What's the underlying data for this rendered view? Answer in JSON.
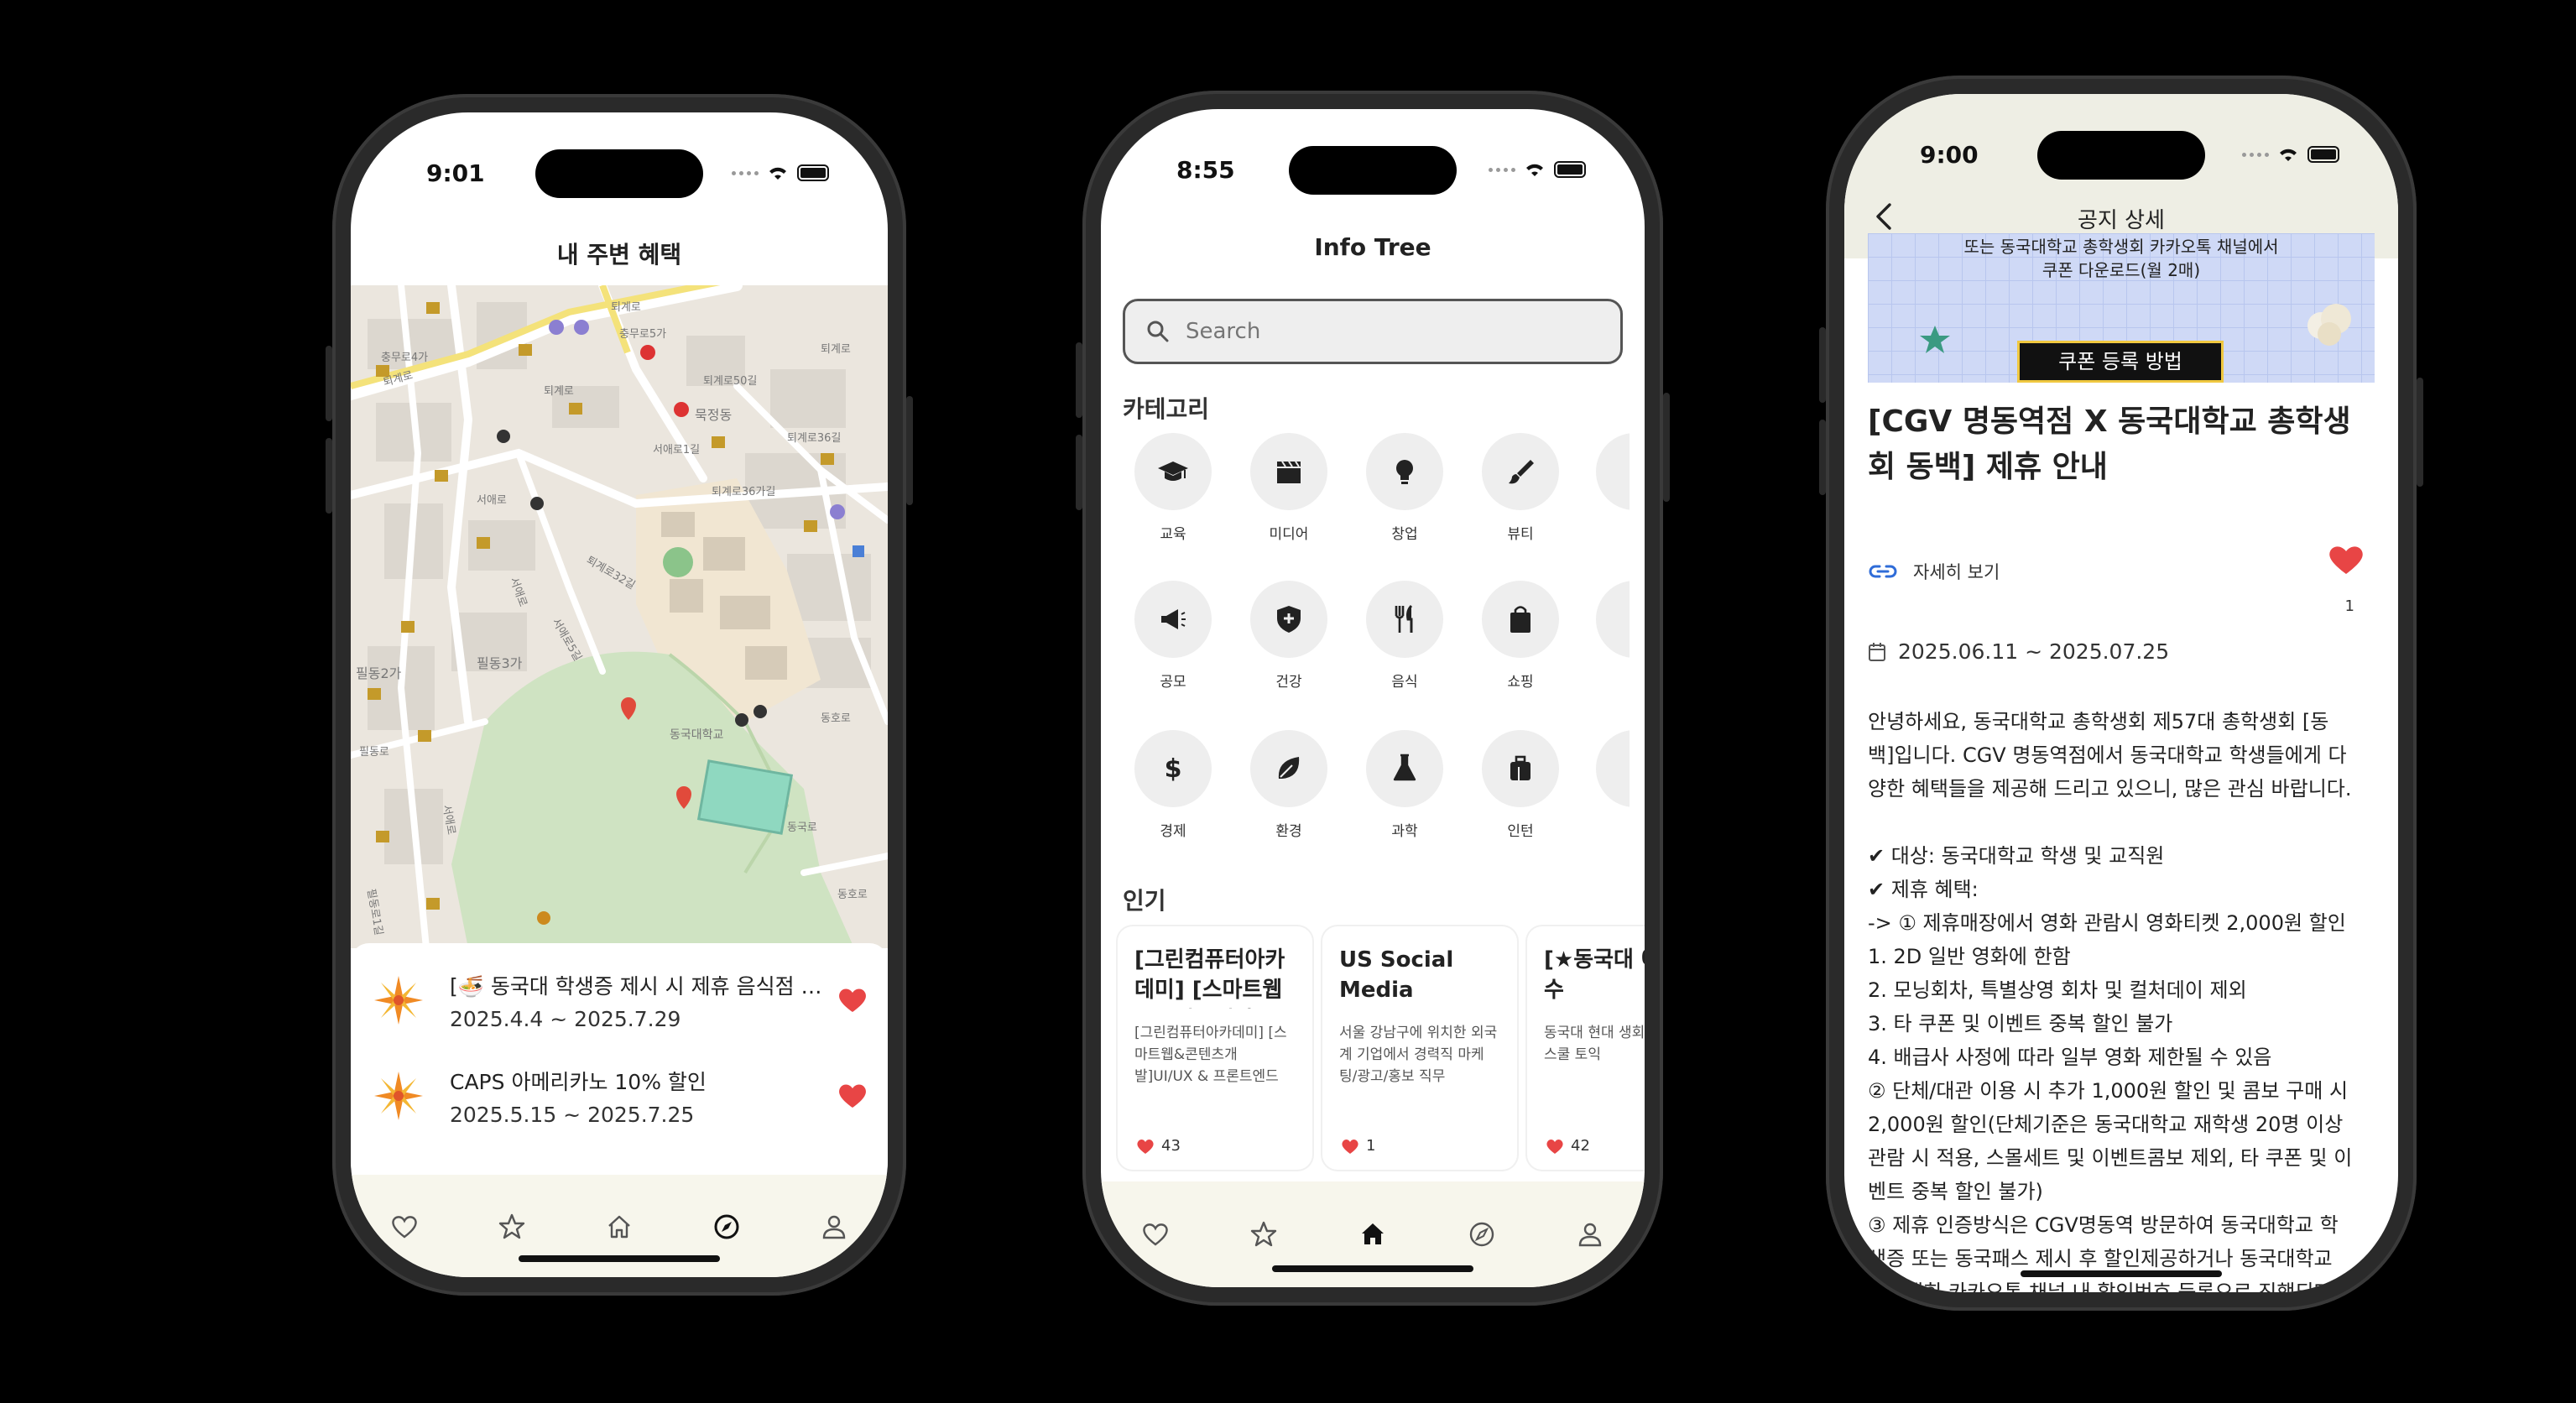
{
  "colors": {
    "accent": "#e84545",
    "tab_bg": "#f7f6ec",
    "link": "#2f6cd8"
  },
  "phone1": {
    "time": "9:01",
    "title": "내 주변 혜택",
    "map_labels": [
      "퇴계로",
      "충무로5가",
      "충무로4가",
      "퇴계로",
      "퇴계로50길",
      "묵정동",
      "서애로1길",
      "필동2가",
      "필동3가",
      "퇴계로",
      "서애로",
      "퇴계로36길",
      "동국대학교",
      "퇴계로32길",
      "퇴계로36가길",
      "필동로",
      "동호로",
      "서애로5길",
      "서애로",
      "필동로1길",
      "서애로",
      "퇴계로",
      "동국로",
      "동호로"
    ],
    "items": [
      {
        "title": "[🍜 동국대 학생증 제시 시 제휴 음식점 안내]",
        "date": "2025.4.4 ~ 2025.7.29"
      },
      {
        "title": "CAPS 아메리카노 10% 할인",
        "date": "2025.5.15 ~ 2025.7.25"
      }
    ],
    "tabs": [
      "heart-icon",
      "star-icon",
      "home-icon",
      "compass-icon",
      "person-icon"
    ]
  },
  "phone2": {
    "time": "8:55",
    "title": "Info Tree",
    "search_placeholder": "Search",
    "category_title": "카테고리",
    "categories": [
      {
        "icon": "graduation-cap-icon",
        "label": "교육"
      },
      {
        "icon": "clapperboard-icon",
        "label": "미디어"
      },
      {
        "icon": "lightbulb-icon",
        "label": "창업"
      },
      {
        "icon": "brush-icon",
        "label": "뷰티"
      },
      {
        "icon": "megaphone-icon",
        "label": "공모"
      },
      {
        "icon": "shield-icon",
        "label": "건강"
      },
      {
        "icon": "utensils-icon",
        "label": "음식"
      },
      {
        "icon": "shopping-bag-icon",
        "label": "쇼핑"
      },
      {
        "icon": "dollar-icon",
        "label": "경제"
      },
      {
        "icon": "leaf-icon",
        "label": "환경"
      },
      {
        "icon": "flask-icon",
        "label": "과학"
      },
      {
        "icon": "briefcase-icon",
        "label": "인턴"
      }
    ],
    "popular_title": "인기",
    "popular": [
      {
        "title": "[그린컴퓨터아카데미] [스마트웹&콘텐츠개발]",
        "desc": "[그린컴퓨터아카데미] [스마트웹&콘텐츠개발]UI/UX & 프론트엔드",
        "likes": "43"
      },
      {
        "title": "US Social Media Marketing",
        "desc": "서울 강남구에 위치한 외국계 기업에서 경력직 마케팅/광고/홍보 직무",
        "likes": "1"
      },
      {
        "title": "[★동국대 에듀윌 수",
        "desc": "동국대 현대 생회를 통해 원스쿨 토익",
        "likes": "42"
      }
    ]
  },
  "phone3": {
    "time": "9:00",
    "title": "공지 상세",
    "banner_line1": "또는 동국대학교 총학생회 카카오톡 채널에서",
    "banner_line2": "쿠폰 다운로드(월 2매)",
    "banner_button": "쿠폰 등록 방법",
    "notice_title": "[CGV 명동역점 X 동국대학교 총학생회 동백] 제휴 안내",
    "link_label": "자세히 보기",
    "like_count": "1",
    "date_range": "2025.06.11 ~ 2025.07.25",
    "body_lines": [
      "안녕하세요, 동국대학교 총학생회 제57대 총학생회 [동",
      "백]입니다. CGV 명동역점에서 동국대학교 학생들에게 다",
      "양한 혜택들을 제공해 드리고 있으니, 많은 관심 바랍니다.",
      "",
      "✔ 대상: 동국대학교 학생 및 교직원",
      "✔ 제휴 혜택:",
      "-> ① 제휴매장에서 영화 관람시 영화티켓 2,000원 할인",
      "1. 2D 일반 영화에 한함",
      "2. 모닝회차, 특별상영 회차 및 컬처데이 제외",
      "3. 타 쿠폰 및 이벤트 중복 할인 불가",
      "4. 배급사 사정에 따라 일부 영화 제한될 수 있음",
      "② 단체/대관 이용 시 추가 1,000원 할인 및 콤보 구매 시",
      "2,000원 할인(단체기준은 동국대학교 재학생 20명 이상",
      "관람 시 적용, 스몰세트 및 이벤트콤보 제외, 타 쿠폰 및 이",
      "벤트 중복 할인 불가)",
      "③ 제휴 인증방식은 CGV명동역 방문하여 동국대학교 학",
      "생증 또는 동국패스 제시 후 할인제공하거나 동국대학교",
      "총학생회 카카오톡 채널 내 할인번호 등록으로 진행되며,"
    ]
  }
}
